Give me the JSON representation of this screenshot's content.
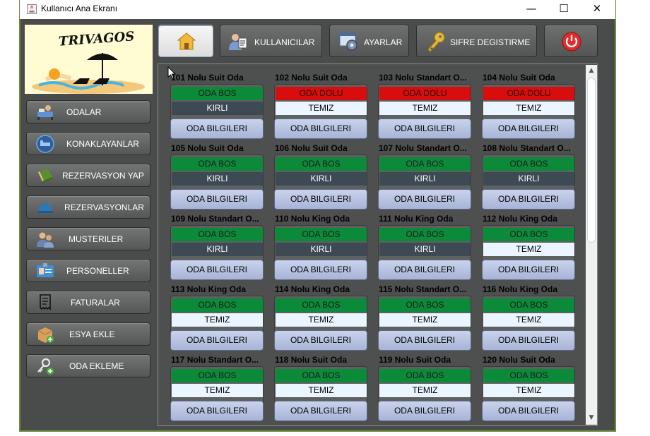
{
  "window": {
    "title": "Kullanıcı Ana Ekranı",
    "minimize_glyph": "—",
    "maximize_glyph": "☐",
    "close_glyph": "✕"
  },
  "logo": {
    "text": "TRIVAGOS"
  },
  "sidebar": {
    "items": [
      {
        "label": "ODALAR",
        "icon": "bed-icon"
      },
      {
        "label": "KONAKLAYANLAR",
        "icon": "bed-circle-icon"
      },
      {
        "label": "REZERVASYON YAP",
        "icon": "book-icon"
      },
      {
        "label": "REZERVASYONLAR",
        "icon": "bell-icon"
      },
      {
        "label": "MUSTERILER",
        "icon": "users-icon"
      },
      {
        "label": "PERSONELLER",
        "icon": "id-card-icon"
      },
      {
        "label": "FATURALAR",
        "icon": "receipt-icon"
      },
      {
        "label": "ESYA EKLE",
        "icon": "box-add-icon"
      },
      {
        "label": "ODA EKLEME",
        "icon": "key-add-icon"
      }
    ]
  },
  "toolbar": {
    "home_icon": "home-icon",
    "users_label": "KULLANICILAR",
    "settings_label": "AYARLAR",
    "password_label": "SIFRE DEGISTIRME",
    "power_icon": "power-icon"
  },
  "rooms": [
    {
      "name": "101 Nolu Suit Oda",
      "status": "ODA BOS",
      "status_type": "bos",
      "clean": "KIRLI",
      "clean_type": "kirli",
      "button": "ODA BILGILERI"
    },
    {
      "name": "102 Nolu Suit Oda",
      "status": "ODA DOLU",
      "status_type": "dolu",
      "clean": "TEMIZ",
      "clean_type": "temiz",
      "button": "ODA BILGILERI"
    },
    {
      "name": "103 Nolu Standart O...",
      "status": "ODA DOLU",
      "status_type": "dolu",
      "clean": "TEMIZ",
      "clean_type": "temiz",
      "button": "ODA BILGILERI"
    },
    {
      "name": "104 Nolu Suit Oda",
      "status": "ODA DOLU",
      "status_type": "dolu",
      "clean": "TEMIZ",
      "clean_type": "temiz",
      "button": "ODA BILGILERI"
    },
    {
      "name": "105 Nolu Suit Oda",
      "status": "ODA BOS",
      "status_type": "bos",
      "clean": "KIRLI",
      "clean_type": "kirli",
      "button": "ODA BILGILERI"
    },
    {
      "name": "106 Nolu Suit Oda",
      "status": "ODA BOS",
      "status_type": "bos",
      "clean": "KIRLI",
      "clean_type": "kirli",
      "button": "ODA BILGILERI"
    },
    {
      "name": "107 Nolu Standart O...",
      "status": "ODA BOS",
      "status_type": "bos",
      "clean": "KIRLI",
      "clean_type": "kirli",
      "button": "ODA BILGILERI"
    },
    {
      "name": "108 Nolu Standart O...",
      "status": "ODA BOS",
      "status_type": "bos",
      "clean": "KIRLI",
      "clean_type": "kirli",
      "button": "ODA BILGILERI"
    },
    {
      "name": "109 Nolu Standart O...",
      "status": "ODA BOS",
      "status_type": "bos",
      "clean": "KIRLI",
      "clean_type": "kirli",
      "button": "ODA BILGILERI"
    },
    {
      "name": "110 Nolu King Oda",
      "status": "ODA BOS",
      "status_type": "bos",
      "clean": "KIRLI",
      "clean_type": "kirli",
      "button": "ODA BILGILERI"
    },
    {
      "name": "111 Nolu King Oda",
      "status": "ODA BOS",
      "status_type": "bos",
      "clean": "KIRLI",
      "clean_type": "kirli",
      "button": "ODA BILGILERI"
    },
    {
      "name": "112 Nolu King Oda",
      "status": "ODA BOS",
      "status_type": "bos",
      "clean": "TEMIZ",
      "clean_type": "temiz",
      "button": "ODA BILGILERI"
    },
    {
      "name": "113 Nolu King Oda",
      "status": "ODA BOS",
      "status_type": "bos",
      "clean": "TEMIZ",
      "clean_type": "temiz",
      "button": "ODA BILGILERI"
    },
    {
      "name": "114 Nolu King Oda",
      "status": "ODA BOS",
      "status_type": "bos",
      "clean": "TEMIZ",
      "clean_type": "temiz",
      "button": "ODA BILGILERI"
    },
    {
      "name": "115 Nolu Standart O...",
      "status": "ODA BOS",
      "status_type": "bos",
      "clean": "TEMIZ",
      "clean_type": "temiz",
      "button": "ODA BILGILERI"
    },
    {
      "name": "116 Nolu King Oda",
      "status": "ODA BOS",
      "status_type": "bos",
      "clean": "TEMIZ",
      "clean_type": "temiz",
      "button": "ODA BILGILERI"
    },
    {
      "name": "117 Nolu Standart O...",
      "status": "ODA BOS",
      "status_type": "bos",
      "clean": "TEMIZ",
      "clean_type": "temiz",
      "button": "ODA BILGILERI"
    },
    {
      "name": "118 Nolu Suit Oda",
      "status": "ODA BOS",
      "status_type": "bos",
      "clean": "TEMIZ",
      "clean_type": "temiz",
      "button": "ODA BILGILERI"
    },
    {
      "name": "119 Nolu Suit Oda",
      "status": "ODA BOS",
      "status_type": "bos",
      "clean": "TEMIZ",
      "clean_type": "temiz",
      "button": "ODA BILGILERI"
    },
    {
      "name": "120 Nolu Suit Oda",
      "status": "ODA BOS",
      "status_type": "bos",
      "clean": "TEMIZ",
      "clean_type": "temiz",
      "button": "ODA BILGILERI"
    }
  ],
  "scrollbar": {
    "up_glyph": "▲",
    "down_glyph": "▼"
  },
  "colors": {
    "status_bos": "#0b8a3a",
    "status_dolu": "#d80d0d",
    "clean_kirli": "#3d4a54",
    "clean_temiz": "#eaf5ff",
    "panel_bg": "#4a4b4b",
    "info_button": "#b8c3e1"
  }
}
